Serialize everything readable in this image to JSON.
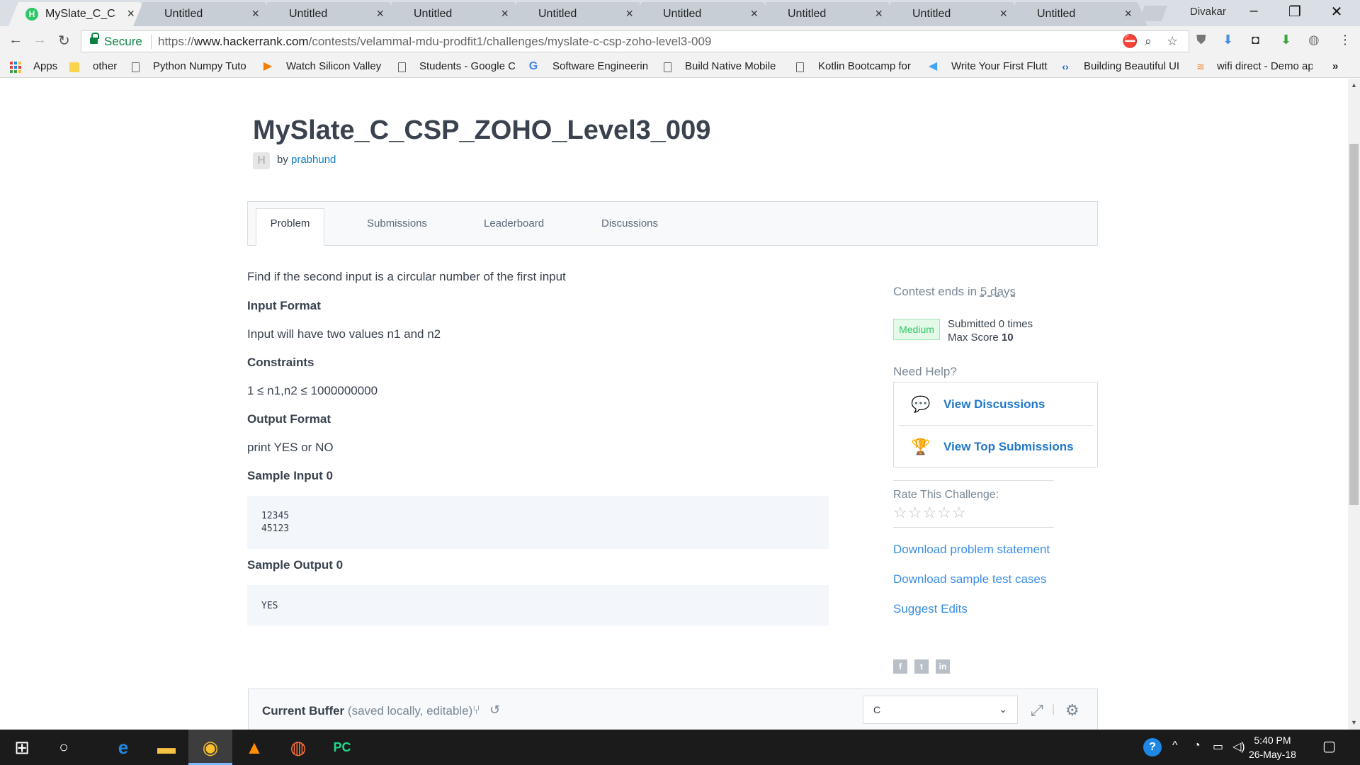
{
  "browser": {
    "tabs": [
      {
        "title": "MySlate_C_CSP",
        "active": true
      },
      {
        "title": "Untitled"
      },
      {
        "title": "Untitled"
      },
      {
        "title": "Untitled"
      },
      {
        "title": "Untitled"
      },
      {
        "title": "Untitled"
      },
      {
        "title": "Untitled"
      },
      {
        "title": "Untitled"
      },
      {
        "title": "Untitled"
      }
    ],
    "favicon_letter": "H",
    "close_glyph": "×",
    "user": "Divakar",
    "secure_label": "Secure",
    "url_scheme": "https://",
    "url_host": "www.hackerrank.com",
    "url_path": "/contests/velammal-mdu-prodfit1/challenges/myslate-c-csp-zoho-level3-009"
  },
  "bookmarks": [
    {
      "label": "Apps",
      "icon": "apps-icon"
    },
    {
      "label": "other",
      "icon": "folder-icon"
    },
    {
      "label": "Python Numpy Tuto",
      "icon": "page-icon"
    },
    {
      "label": "Watch Silicon Valley",
      "icon": "play-icon"
    },
    {
      "label": "Students - Google C",
      "icon": "page-icon"
    },
    {
      "label": "Software Engineerin",
      "icon": "google-icon"
    },
    {
      "label": "Build Native Mobile",
      "icon": "page-icon"
    },
    {
      "label": "Kotlin Bootcamp for",
      "icon": "page-icon"
    },
    {
      "label": "Write Your First Flutt",
      "icon": "flutter-icon"
    },
    {
      "label": "Building Beautiful UI",
      "icon": "code-icon"
    },
    {
      "label": "wifi direct - Demo ap",
      "icon": "stackoverflow-icon"
    }
  ],
  "challenge": {
    "title": "MySlate_C_CSP_ZOHO_Level3_009",
    "by": "by",
    "author": "prabhund",
    "avatar_letter": "H"
  },
  "tabs": [
    "Problem",
    "Submissions",
    "Leaderboard",
    "Discussions"
  ],
  "problem": {
    "statement": "Find if the second input is a circular number of the first input",
    "input_format_h": "Input Format",
    "input_format": "Input will have two values n1 and n2",
    "constraints_h": "Constraints",
    "constraints": "1 ≤ n1,n2 ≤ 1000000000",
    "output_format_h": "Output Format",
    "output_format": "print YES or NO",
    "sample_input_h": "Sample Input 0",
    "sample_input": "12345\n45123",
    "sample_output_h": "Sample Output 0",
    "sample_output": "YES"
  },
  "sidebar": {
    "contest_ends_prefix": "Contest ends in",
    "contest_ends_value": "5 days",
    "difficulty": "Medium",
    "submitted": "Submitted 0 times",
    "max_score_label": "Max Score",
    "max_score_value": "10",
    "need_help": "Need Help?",
    "view_discussions": "View Discussions",
    "view_top_submissions": "View Top Submissions",
    "rate_label": "Rate This Challenge:",
    "stars": "☆☆☆☆☆",
    "rating": 0,
    "download_statement": "Download problem statement",
    "download_tests": "Download sample test cases",
    "suggest_edits": "Suggest Edits"
  },
  "editor": {
    "title": "Current Buffer",
    "subtitle": "(saved locally, editable)",
    "language": "C"
  },
  "taskbar": {
    "time": "5:40 PM",
    "date": "26-May-18",
    "apps": [
      "start-icon",
      "cortana-icon",
      "edge-icon",
      "file-explorer-icon",
      "chrome-icon",
      "vlc-icon",
      "firefox-icon",
      "pycharm-icon"
    ]
  }
}
